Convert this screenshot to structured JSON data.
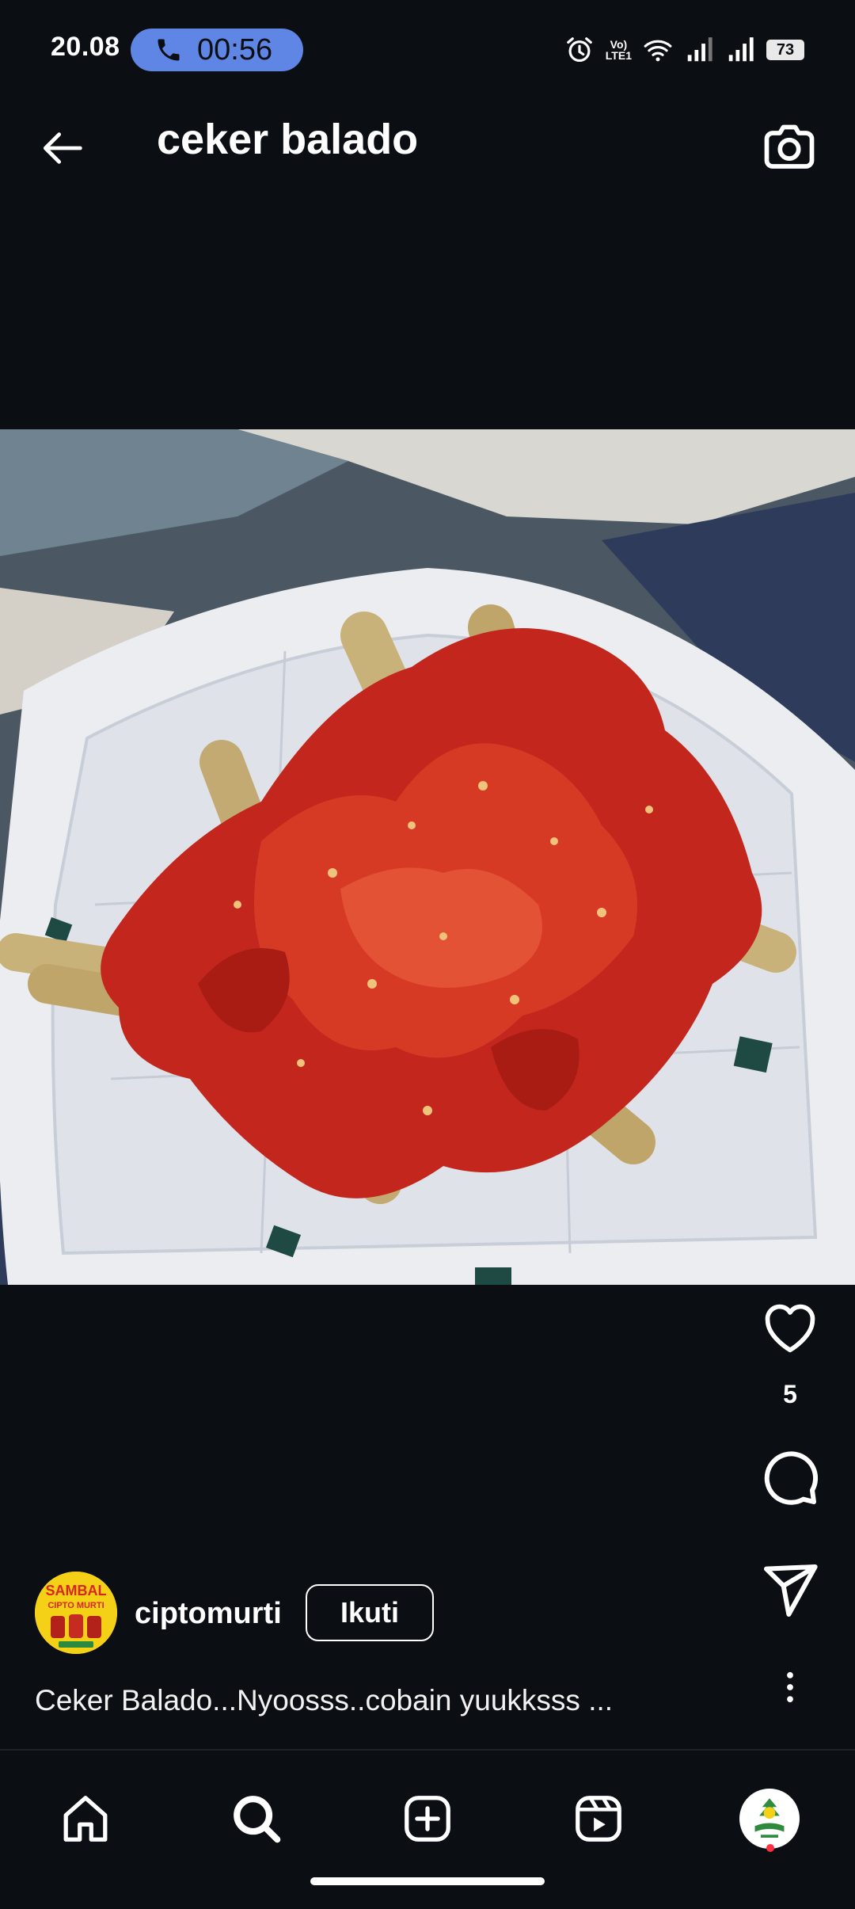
{
  "status_bar": {
    "time": "20.08",
    "call_duration": "00:56",
    "lte_top": "Vo)",
    "lte_bottom": "LTE1",
    "battery": "73"
  },
  "header": {
    "title": "ceker balado"
  },
  "post": {
    "like_count": "5",
    "username": "ciptomurti",
    "follow_label": "Ikuti",
    "caption": "Ceker Balado...Nyoosss..cobain yuukksss ...",
    "avatar_text": [
      "SAMBAL",
      "CIPTO MURTI"
    ]
  },
  "colors": {
    "background": "#0b0f14",
    "call_pill": "#5f86e5",
    "notification_dot": "#ff3040",
    "avatar_yellow": "#f4d117"
  },
  "icons": {
    "back": "arrow-left-icon",
    "camera": "camera-icon",
    "like": "heart-icon",
    "comment": "comment-icon",
    "share": "send-icon",
    "more": "more-vertical-icon",
    "home": "home-icon",
    "search": "search-icon",
    "create": "plus-square-icon",
    "reels": "reels-icon"
  }
}
